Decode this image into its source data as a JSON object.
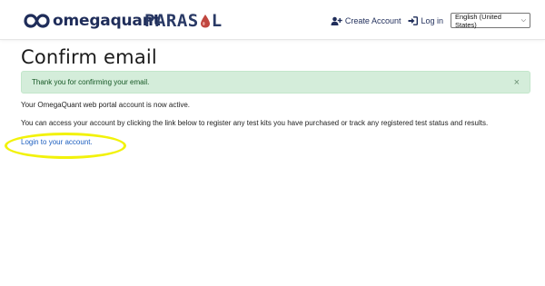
{
  "header": {
    "brand_name": "omegaquant",
    "partner_name_left": "PARAS",
    "partner_name_right": "L",
    "create_account_label": "Create Account",
    "login_label": "Log in",
    "language_selected": "English (United States)"
  },
  "page": {
    "title": "Confirm email",
    "alert_message": "Thank you for confirming your email.",
    "alert_close": "×",
    "paragraph_1": "Your OmegaQuant web portal account is now active.",
    "paragraph_2": "You can access your account by clicking the link below to register any test kits you have purchased or track any registered test status and results.",
    "login_link": "Login to your account."
  },
  "colors": {
    "brand_navy": "#1f2d5a",
    "alert_bg": "#d4edda",
    "alert_text": "#155724",
    "link": "#1d5fbf",
    "highlight": "#f2f20a",
    "drop_red": "#c0463f"
  },
  "icons": {
    "brand": "infinity-logo-icon",
    "create_account": "user-plus-icon",
    "login": "sign-in-icon",
    "drop": "blood-drop-icon",
    "close": "close-icon"
  }
}
